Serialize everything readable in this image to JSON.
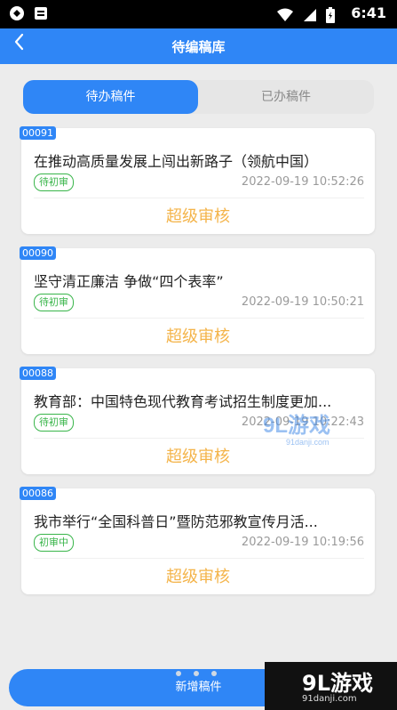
{
  "status_bar": {
    "time": "6:41"
  },
  "header": {
    "title": "待编稿库"
  },
  "tabs": [
    {
      "label": "待办稿件"
    },
    {
      "label": "已办稿件"
    }
  ],
  "cards": [
    {
      "id": "00091",
      "title": "在推动高质量发展上闯出新路子（领航中国）",
      "status": "待初审",
      "date": "2022-09-19 10:52:26",
      "action": "超级审核"
    },
    {
      "id": "00090",
      "title": "坚守清正廉洁 争做“四个表率”",
      "status": "待初审",
      "date": "2022-09-19 10:50:21",
      "action": "超级审核"
    },
    {
      "id": "00088",
      "title": "教育部：中国特色现代教育考试招生制度更加...",
      "status": "待初审",
      "date": "2022-09-19 10:22:43",
      "action": "超级审核"
    },
    {
      "id": "00086",
      "title": "我市举行“全国科普日”暨防范邪教宣传月活...",
      "status": "初审中",
      "date": "2022-09-19 10:19:56",
      "action": "超级审核"
    }
  ],
  "bottom": {
    "new_button": "新增稿件"
  },
  "watermark": {
    "logo": "9L游戏",
    "url": "91danji.com",
    "mid_logo": "9L游戏",
    "mid_url": "91danji.com"
  },
  "colors": {
    "primary": "#2f86f6",
    "status_green": "#39b54a",
    "action_orange": "#f4b44a"
  },
  "icons": [
    "app-icon",
    "sim-icon",
    "wifi-icon",
    "signal-icon",
    "battery-icon",
    "back-arrow-icon"
  ]
}
